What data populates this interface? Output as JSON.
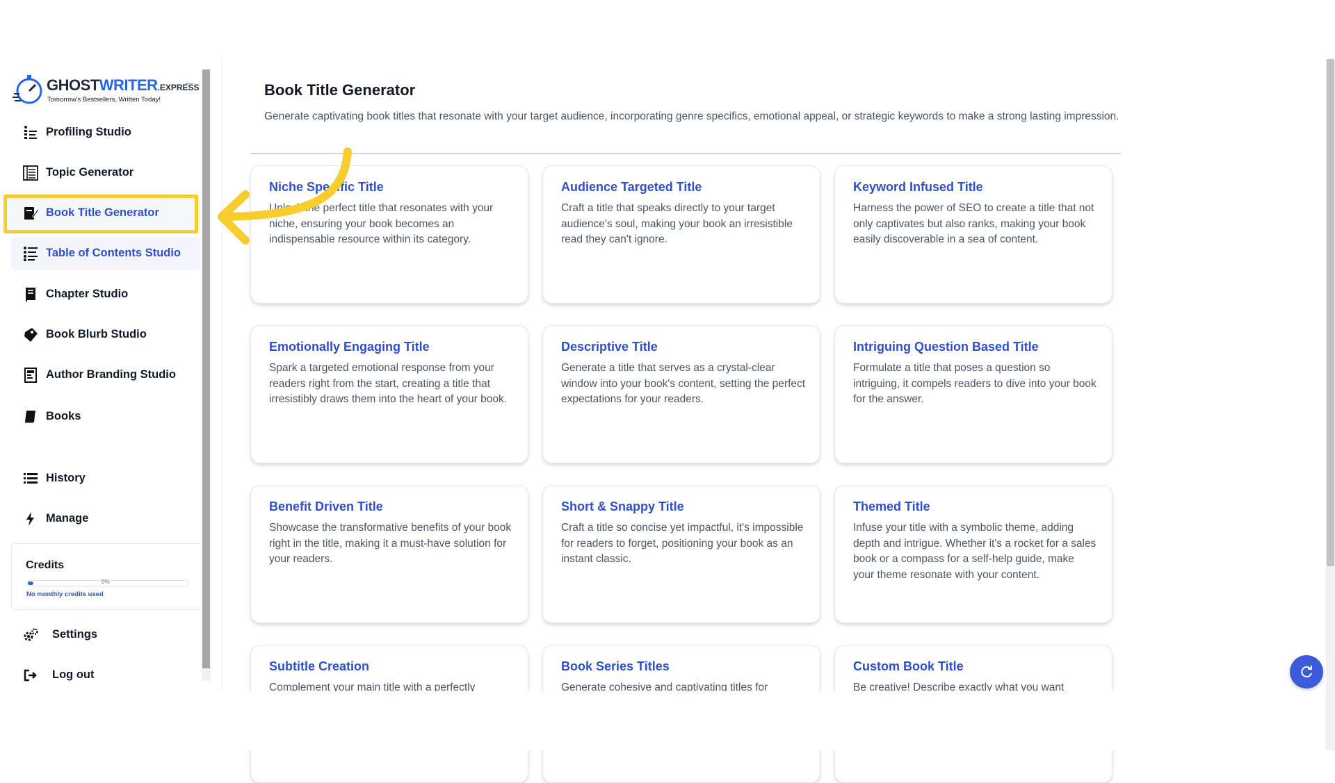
{
  "app": {
    "logo_text_main": "GHOST",
    "logo_text_accent": "WRITER",
    "logo_text_suffix": ".EXPRESS",
    "logo_tagline": "Tomorrow's Bestsellers, Written Today!"
  },
  "sidebar": {
    "items": [
      {
        "label": "Profiling Studio",
        "icon": "profiling-icon"
      },
      {
        "label": "Topic Generator",
        "icon": "topic-icon"
      },
      {
        "label": "Book Title Generator",
        "icon": "book-title-icon"
      },
      {
        "label": "Table of Contents Studio",
        "icon": "toc-icon"
      },
      {
        "label": "Chapter Studio",
        "icon": "chapter-icon"
      },
      {
        "label": "Book Blurb Studio",
        "icon": "blurb-icon"
      },
      {
        "label": "Author Branding Studio",
        "icon": "branding-icon"
      },
      {
        "label": "Books",
        "icon": "books-icon"
      }
    ],
    "secondary": [
      {
        "label": "History",
        "icon": "history-icon"
      },
      {
        "label": "Manage",
        "icon": "manage-icon"
      }
    ],
    "credits": {
      "title": "Credits",
      "percent_label": "0%",
      "percent_value": 0.02,
      "note": "No monthly credits used"
    },
    "footer": [
      {
        "label": "Settings",
        "icon": "settings-icon"
      },
      {
        "label": "Log out",
        "icon": "logout-icon"
      }
    ]
  },
  "main": {
    "title": "Book Title Generator",
    "description": "Generate captivating book titles that resonate with your target audience, incorporating genre specifics, emotional appeal, or strategic keywords to make a strong lasting impression.",
    "cards": [
      {
        "title": "Niche Specific Title",
        "desc": "Unlock the perfect title that resonates with your niche, ensuring your book becomes an indispensable resource within its category."
      },
      {
        "title": "Audience Targeted Title",
        "desc": "Craft a title that speaks directly to your target audience's soul, making your book an irresistible read they can't ignore."
      },
      {
        "title": "Keyword Infused Title",
        "desc": "Harness the power of SEO to create a title that not only captivates but also ranks, making your book easily discoverable in a sea of content."
      },
      {
        "title": "Emotionally Engaging Title",
        "desc": "Spark a targeted emotional response from your readers right from the start, creating a title that irresistibly draws them into the heart of your book."
      },
      {
        "title": "Descriptive Title",
        "desc": "Generate a title that serves as a crystal-clear window into your book's content, setting the perfect expectations for your readers."
      },
      {
        "title": "Intriguing Question Based Title",
        "desc": "Formulate a title that poses a question so intriguing, it compels readers to dive into your book for the answer."
      },
      {
        "title": "Benefit Driven Title",
        "desc": "Showcase the transformative benefits of your book right in the title, making it a must-have solution for your readers."
      },
      {
        "title": "Short & Snappy Title",
        "desc": "Craft a title so concise yet impactful, it's impossible for readers to forget, positioning your book as an instant classic."
      },
      {
        "title": "Themed Title",
        "desc": "Infuse your title with a symbolic theme, adding depth and intrigue. Whether it's a rocket for a sales book or a compass for a self-help guide, make your theme resonate with your content."
      },
      {
        "title": "Subtitle Creation",
        "desc": "Complement your main title with a perfectly"
      },
      {
        "title": "Book Series Titles",
        "desc": "Generate cohesive and captivating titles for"
      },
      {
        "title": "Custom Book Title",
        "desc": "Be creative! Describe exactly what you want"
      }
    ]
  },
  "colors": {
    "accent": "#2f4ec9",
    "highlight": "#f7cd2e",
    "fab": "#3b5bdb"
  }
}
